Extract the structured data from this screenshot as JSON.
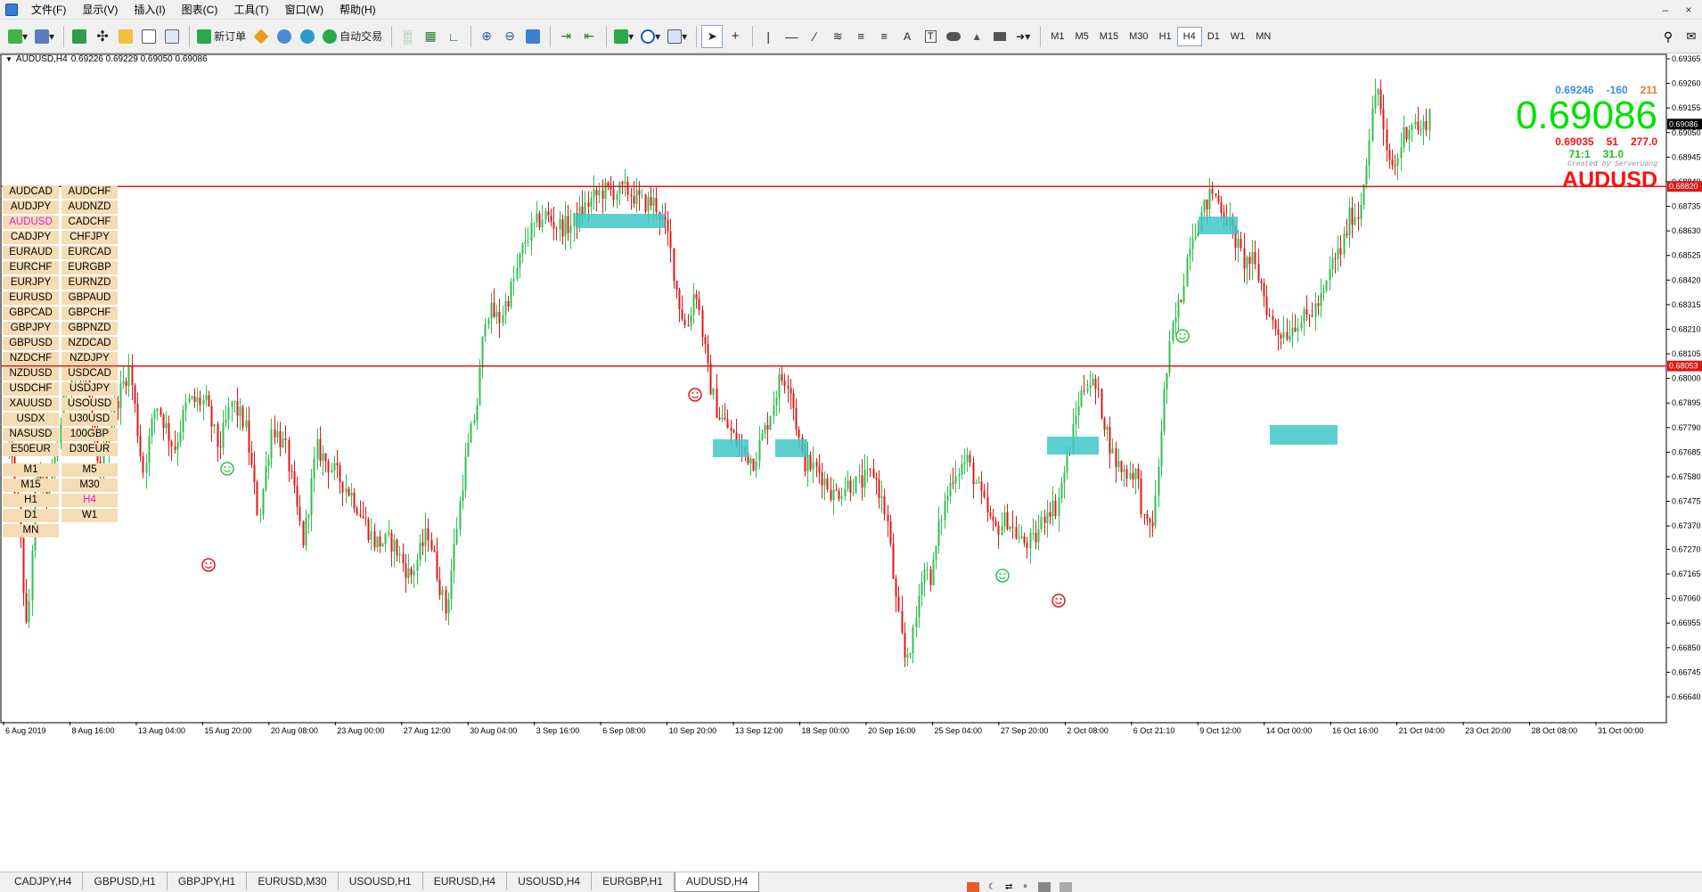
{
  "menu": {
    "items": [
      "文件(F)",
      "显示(V)",
      "插入(I)",
      "图表(C)",
      "工具(T)",
      "窗口(W)",
      "帮助(H)"
    ]
  },
  "toolbar": {
    "new_order_label": "新订单",
    "auto_trade_label": "自动交易",
    "timeframes": [
      "M1",
      "M5",
      "M15",
      "M30",
      "H1",
      "H4",
      "D1",
      "W1",
      "MN"
    ],
    "active_timeframe": "H4"
  },
  "chart": {
    "symbol_tf": "AUDUSD,H4",
    "ohlc": "0.69226 0.69229 0.69050 0.69086",
    "price_axis": [
      "0.69365",
      "0.69260",
      "0.69155",
      "0.69050",
      "0.68945",
      "0.68840",
      "0.68735",
      "0.68630",
      "0.68525",
      "0.68420",
      "0.68315",
      "0.68210",
      "0.68105",
      "0.68000",
      "0.67895",
      "0.67790",
      "0.67685",
      "0.67580",
      "0.67475",
      "0.67370",
      "0.67270",
      "0.67165",
      "0.67060",
      "0.66955",
      "0.66850",
      "0.66745",
      "0.66640"
    ],
    "current_price_tag": "0.69086",
    "line_tags": [
      "0.68820",
      "0.68053"
    ],
    "time_axis": [
      "6 Aug 2019",
      "8 Aug 16:00",
      "13 Aug 04:00",
      "15 Aug 20:00",
      "20 Aug 08:00",
      "23 Aug 00:00",
      "27 Aug 12:00",
      "30 Aug 04:00",
      "3 Sep 16:00",
      "6 Sep 08:00",
      "10 Sep 20:00",
      "13 Sep 12:00",
      "18 Sep 00:00",
      "20 Sep 16:00",
      "25 Sep 04:00",
      "27 Sep 20:00",
      "2 Oct 08:00",
      "6 Oct 21:10",
      "9 Oct 12:00",
      "14 Oct 00:00",
      "16 Oct 16:00",
      "21 Oct 04:00",
      "23 Oct 20:00",
      "28 Oct 08:00",
      "31 Oct 00:00"
    ],
    "colors": {
      "bull": "#2fbf4f",
      "bear": "#e01818",
      "line": "#e01818",
      "zone": "#40c8c8"
    }
  },
  "info": {
    "bid": "0.69246",
    "change": "-160",
    "count": "211",
    "price": "0.69086",
    "low": "0.69035",
    "v1": "51",
    "v2": "277.0",
    "ratio": "71:1",
    "v3": "31.0",
    "created": "Created by ServerUang",
    "symbol": "AUDUSD"
  },
  "symbols": [
    [
      "AUDCAD",
      "AUDCHF"
    ],
    [
      "AUDJPY",
      "AUDNZD"
    ],
    [
      "AUDUSD",
      "CADCHF"
    ],
    [
      "CADJPY",
      "CHFJPY"
    ],
    [
      "EURAUD",
      "EURCAD"
    ],
    [
      "EURCHF",
      "EURGBP"
    ],
    [
      "EURJPY",
      "EURNZD"
    ],
    [
      "EURUSD",
      "GBPAUD"
    ],
    [
      "GBPCAD",
      "GBPCHF"
    ],
    [
      "GBPJPY",
      "GBPNZD"
    ],
    [
      "GBPUSD",
      "NZDCAD"
    ],
    [
      "NZDCHF",
      "NZDJPY"
    ],
    [
      "NZDUSD",
      "USDCAD"
    ],
    [
      "USDCHF",
      "USDJPY"
    ],
    [
      "XAUUSD",
      "USOUSD"
    ],
    [
      "USDX",
      "U30USD"
    ],
    [
      "NASUSD",
      "100GBP"
    ],
    [
      "E50EUR",
      "D30EUR"
    ]
  ],
  "active_symbol": "AUDUSD",
  "tf_buttons": [
    [
      "M1",
      "M5"
    ],
    [
      "M15",
      "M30"
    ],
    [
      "H1",
      "H4"
    ],
    [
      "D1",
      "W1"
    ],
    [
      "MN",
      ""
    ]
  ],
  "tabs": [
    "CADJPY,H4",
    "GBPUSD,H1",
    "GBPJPY,H1",
    "EURUSD,M30",
    "USOUSD,H1",
    "EURUSD,H4",
    "USOUSD,H4",
    "EURGBP,H1",
    "AUDUSD,H4"
  ],
  "active_tab": "AUDUSD,H4"
}
